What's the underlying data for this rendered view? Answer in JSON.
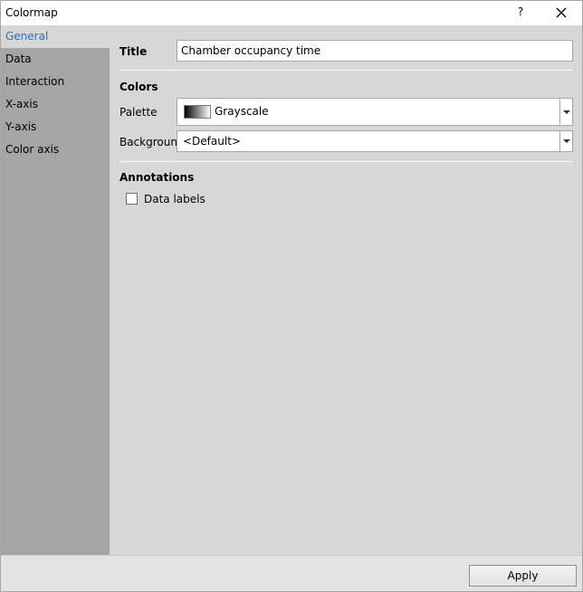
{
  "window": {
    "title": "Colormap",
    "help_label": "?"
  },
  "sidebar": {
    "items": [
      {
        "label": "General",
        "active": true
      },
      {
        "label": "Data"
      },
      {
        "label": "Interaction"
      },
      {
        "label": "X-axis"
      },
      {
        "label": "Y-axis"
      },
      {
        "label": "Color axis"
      }
    ]
  },
  "general": {
    "title_label": "Title",
    "title_value": "Chamber occupancy time",
    "colors_section": "Colors",
    "palette_label": "Palette",
    "palette_value": "Grayscale",
    "palette_gradient": [
      "#000000",
      "#ffffff"
    ],
    "background_label": "Background",
    "background_value": "<Default>",
    "annotations_section": "Annotations",
    "data_labels_label": "Data labels",
    "data_labels_checked": false
  },
  "footer": {
    "apply_label": "Apply"
  },
  "colors": {
    "sidebar_active_text": "#2a6ec5",
    "sidebar_bg": "#a5a5a5",
    "panel_bg": "#d7d7d7"
  }
}
